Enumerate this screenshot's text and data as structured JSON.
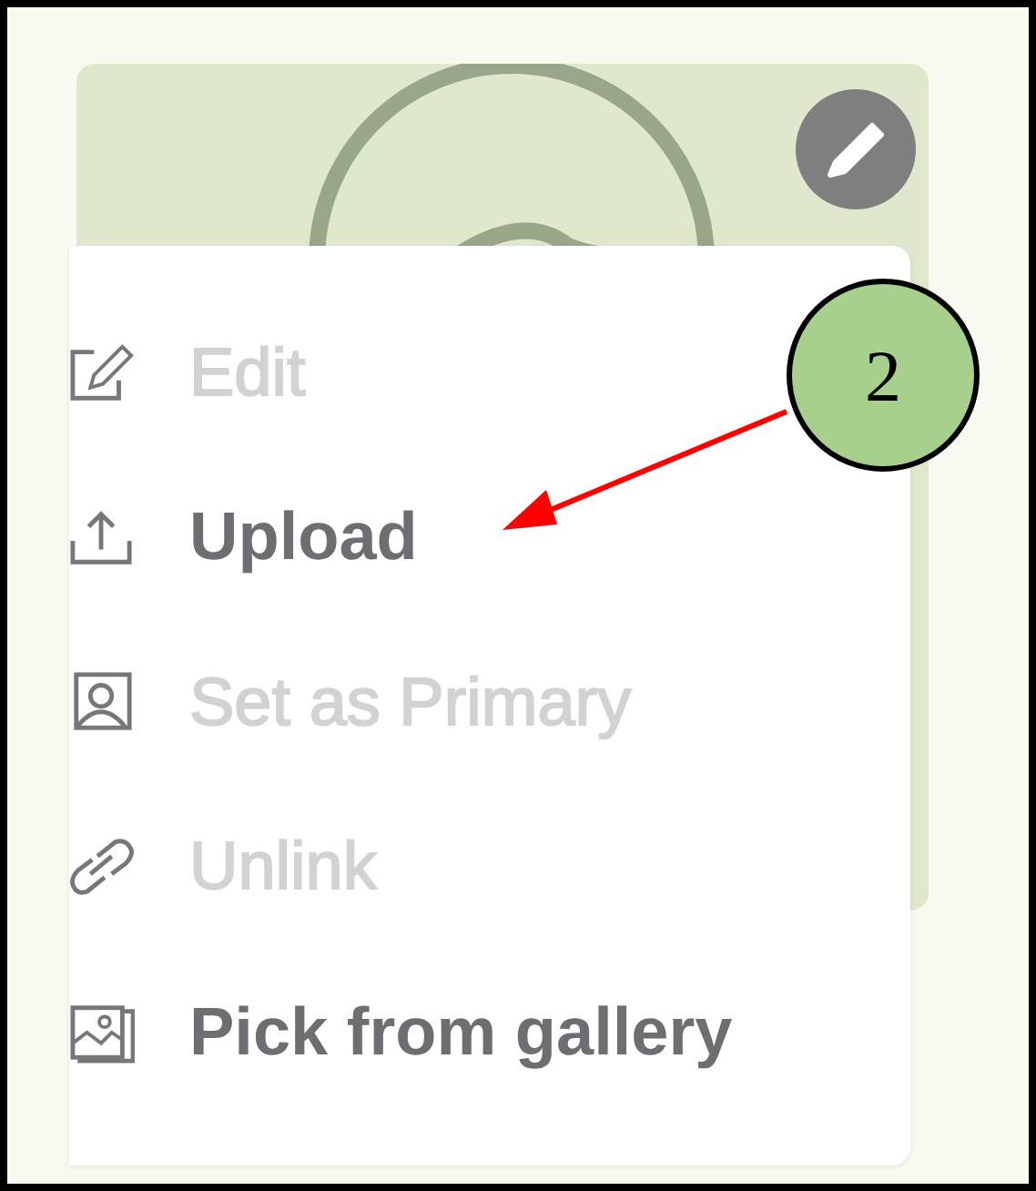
{
  "menu": {
    "items": [
      {
        "kind": "edit",
        "label": "Edit",
        "disabled": true
      },
      {
        "kind": "upload",
        "label": "Upload",
        "disabled": false
      },
      {
        "kind": "person",
        "label": "Set as Primary",
        "disabled": true
      },
      {
        "kind": "link",
        "label": "Unlink",
        "disabled": true
      },
      {
        "kind": "gallery",
        "label": "Pick from gallery",
        "disabled": false
      }
    ]
  },
  "callout": {
    "label": "2"
  }
}
